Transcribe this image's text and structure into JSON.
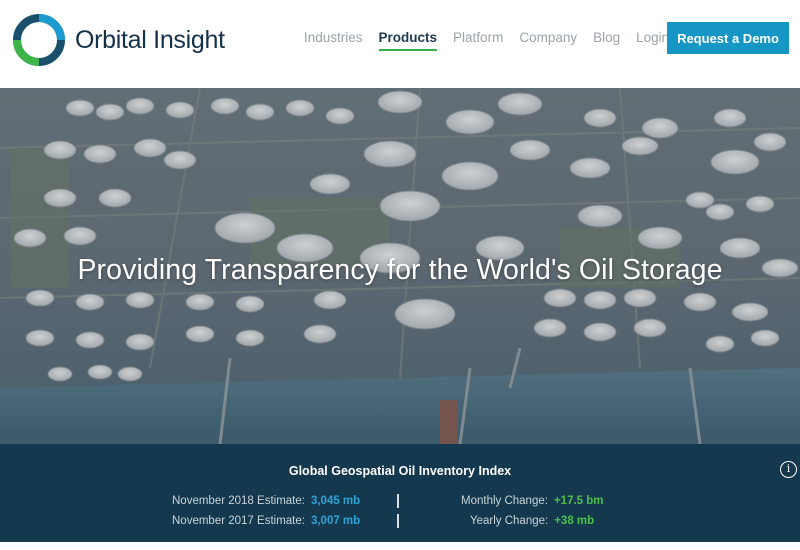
{
  "header": {
    "brand": "Orbital Insight",
    "nav": [
      "Industries",
      "Products",
      "Platform",
      "Company",
      "Blog",
      "Login"
    ],
    "active_nav": "Products",
    "demo_button": "Request a Demo"
  },
  "hero": {
    "title": "Providing Transparency for the World's Oil Storage"
  },
  "index": {
    "title": "Global Geospatial Oil Inventory Index",
    "info": "i",
    "rows": [
      {
        "label": "November 2018 Estimate:",
        "value": "3,045 mb",
        "change_label": "Monthly Change:",
        "change_value": "+17.5 bm"
      },
      {
        "label": "November 2017 Estimate:",
        "value": "3,007 mb",
        "change_label": "Yearly Change:",
        "change_value": "+38 mb"
      }
    ]
  },
  "colors": {
    "brand_navy": "#14384e",
    "accent_blue": "#1696c4",
    "accent_green": "#3dae4a"
  }
}
